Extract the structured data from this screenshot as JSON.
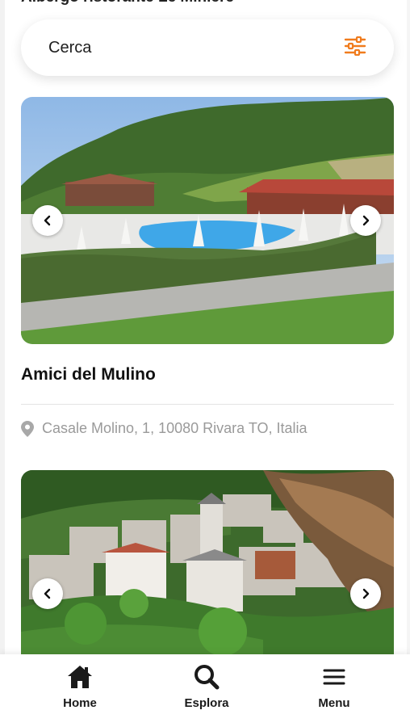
{
  "header": {
    "title_partial": "Albergo ristorante Le Miniere"
  },
  "search": {
    "placeholder": "Cerca",
    "accent_color": "#f07c1e"
  },
  "listings": [
    {
      "title": "Amici del Mulino",
      "address": "Casale Molino, 1, 10080 Rivara TO, Italia"
    },
    {
      "title": "",
      "address": ""
    }
  ],
  "bottom_nav": [
    {
      "label": "Home",
      "icon": "home-icon"
    },
    {
      "label": "Esplora",
      "icon": "search-icon"
    },
    {
      "label": "Menu",
      "icon": "menu-icon"
    }
  ]
}
